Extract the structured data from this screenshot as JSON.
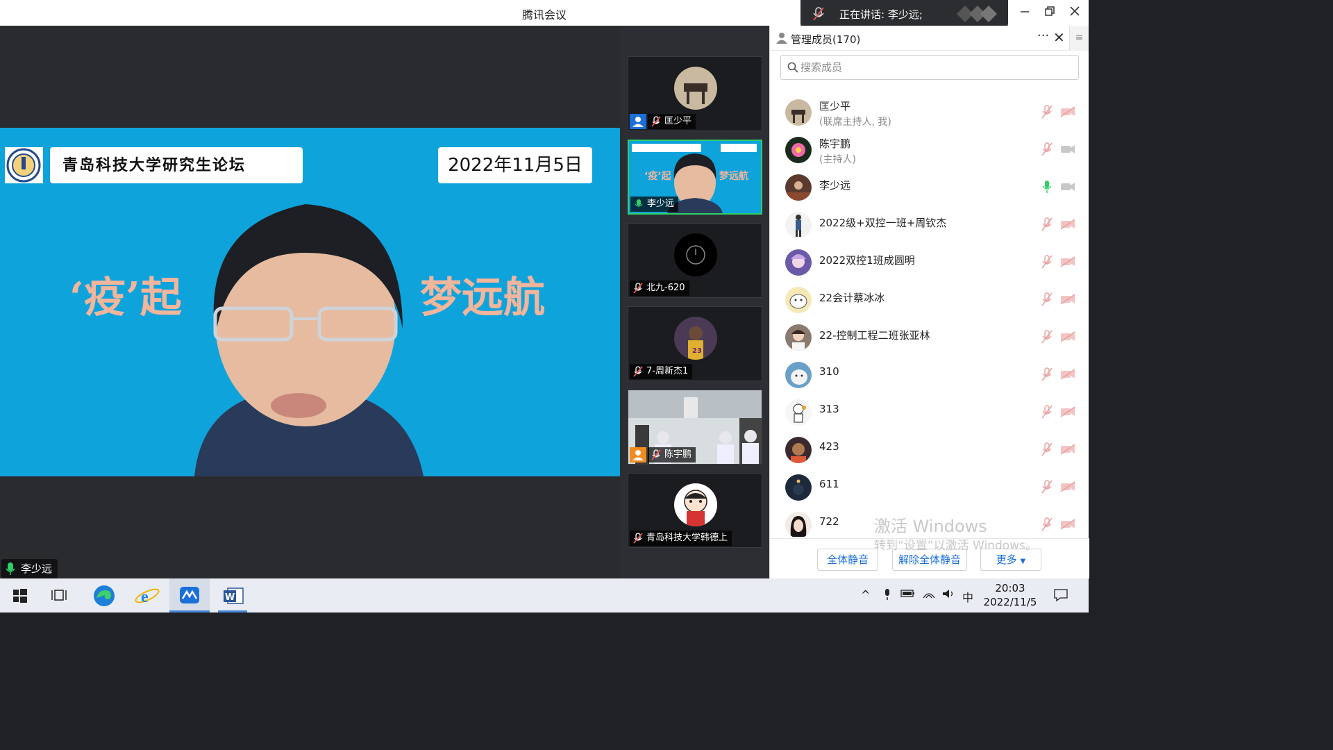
{
  "window": {
    "title": "腾讯会议",
    "speaking_text": "正在讲话: 李少远;",
    "minimize_icon": "minimize-icon",
    "restore_icon": "restore-icon",
    "close_icon": "close-icon"
  },
  "main_video": {
    "banner_title": "青岛科技大学研究生论坛",
    "banner_date": "2022年11月5日",
    "slogan_left": "‘疫’起",
    "slogan_right": "梦远航",
    "speaker_name": "李少远"
  },
  "thumbnails": [
    {
      "name": "匡少平",
      "mic": "muted",
      "host_badge": "blue"
    },
    {
      "name": "李少远",
      "mic": "active"
    },
    {
      "name": "北九-620",
      "mic": "muted"
    },
    {
      "name": "7-周新杰1",
      "mic": "muted"
    },
    {
      "name": "陈宇鹏",
      "mic": "muted",
      "host_badge": "orange"
    },
    {
      "name": "青岛科技大学韩德上",
      "mic": "muted"
    }
  ],
  "panel": {
    "title": "管理成员(170)",
    "search_placeholder": "搜索成员",
    "members": [
      {
        "name": "匡少平",
        "role": "(联席主持人, 我)",
        "mic": "muted",
        "cam": "off"
      },
      {
        "name": "陈宇鹏",
        "role": "(主持人)",
        "mic": "muted",
        "cam": "on"
      },
      {
        "name": "李少远",
        "role": "",
        "mic": "active",
        "cam": "on"
      },
      {
        "name": "2022级+双控一班+周钦杰",
        "role": "",
        "mic": "muted",
        "cam": "off"
      },
      {
        "name": "2022双控1班成圆明",
        "role": "",
        "mic": "muted",
        "cam": "off"
      },
      {
        "name": "22会计蔡冰冰",
        "role": "",
        "mic": "muted",
        "cam": "off"
      },
      {
        "name": "22-控制工程二班张亚林",
        "role": "",
        "mic": "muted",
        "cam": "off"
      },
      {
        "name": "310",
        "role": "",
        "mic": "muted",
        "cam": "off"
      },
      {
        "name": "313",
        "role": "",
        "mic": "muted",
        "cam": "off"
      },
      {
        "name": "423",
        "role": "",
        "mic": "muted",
        "cam": "off"
      },
      {
        "name": "611",
        "role": "",
        "mic": "muted",
        "cam": "off"
      },
      {
        "name": "722",
        "role": "",
        "mic": "muted",
        "cam": "off"
      }
    ],
    "mute_all": "全体静音",
    "unmute_all": "解除全体静音",
    "more": "更多"
  },
  "watermark": {
    "line1": "激活 Windows",
    "line2": "转到“设置”以激活 Windows。"
  },
  "taskbar": {
    "time": "20:03",
    "date": "2022/11/5",
    "ime": "中"
  },
  "colors": {
    "accent": "#1a6fd8",
    "active_mic": "#2fd06a",
    "muted_mic": "#e05555"
  }
}
